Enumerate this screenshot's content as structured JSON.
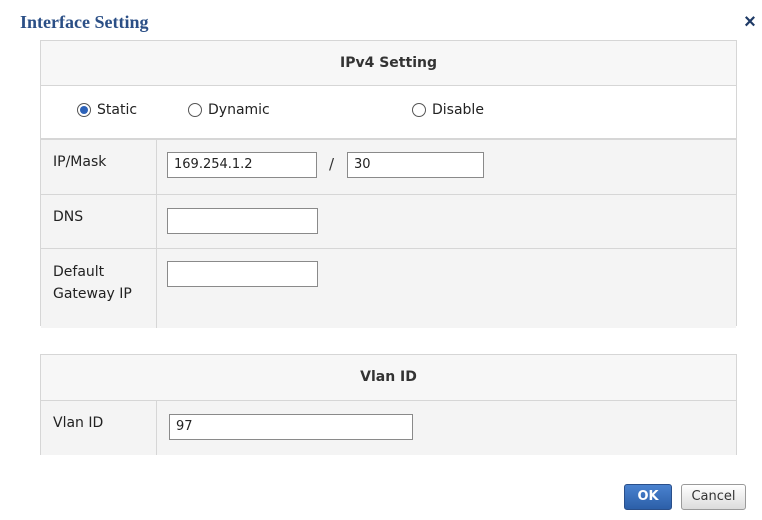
{
  "dialog": {
    "title": "Interface Setting",
    "close_label": "×"
  },
  "ipv4": {
    "heading": "IPv4 Setting",
    "mode_options": [
      {
        "label": "Static",
        "selected": true
      },
      {
        "label": "Dynamic",
        "selected": false
      },
      {
        "label": "Disable",
        "selected": false
      }
    ],
    "ip_mask_label": "IP/Mask",
    "ip_value": "169.254.1.2",
    "mask_separator": "/",
    "mask_value": "30",
    "dns_label": "DNS",
    "dns_value": "",
    "gateway_label_line1": "Default",
    "gateway_label_line2": "Gateway IP",
    "gateway_value": ""
  },
  "vlan": {
    "heading": "Vlan ID",
    "label": "Vlan ID",
    "value": "97"
  },
  "buttons": {
    "ok": "OK",
    "cancel": "Cancel"
  },
  "colors": {
    "title": "#2b4f86",
    "radio_selected": "#2d62b8",
    "ok_button": "#2c5fa8"
  }
}
